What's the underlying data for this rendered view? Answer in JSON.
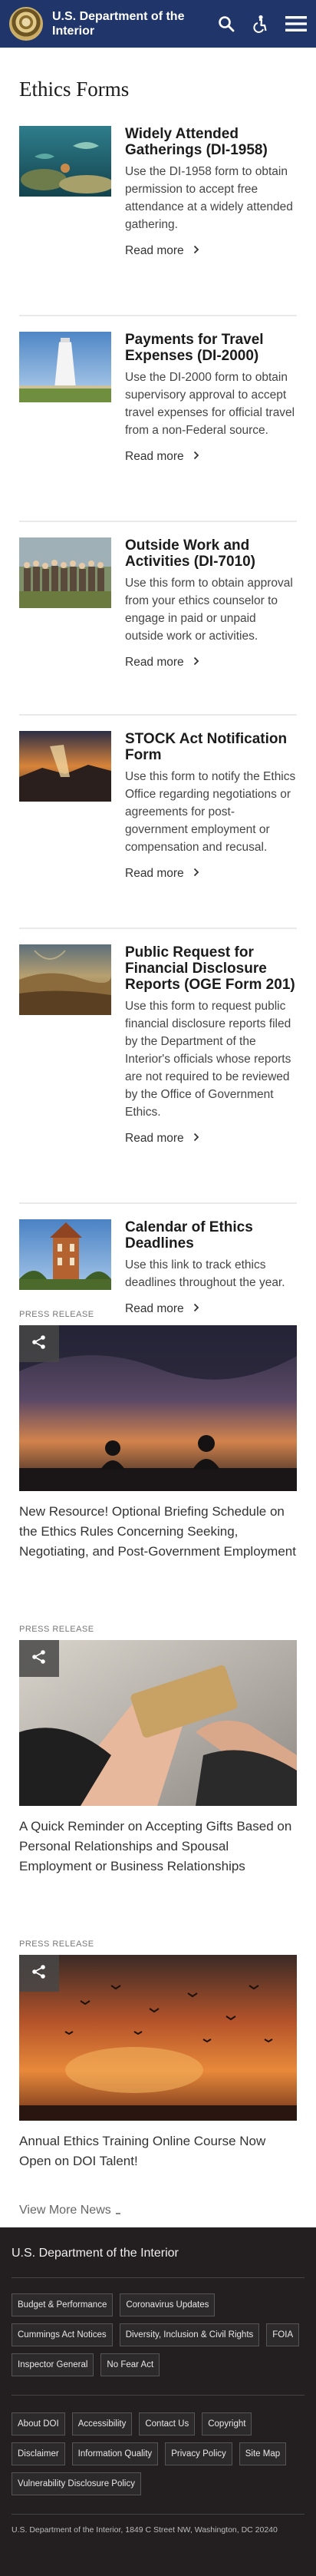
{
  "header": {
    "site_title": "U.S. Department of the Interior",
    "icons": [
      "doi-seal",
      "search-icon",
      "accessibility-icon",
      "menu-icon"
    ],
    "bg_color": "#203569"
  },
  "page_title": "Ethics Forms",
  "forms": [
    {
      "title": "Widely Attended Gatherings (DI-1958)",
      "desc": "Use the DI-1958 form to obtain permission to accept free attendance at a widely attended gathering.",
      "read_more": "Read more"
    },
    {
      "title": "Payments for Travel Expenses (DI-2000)",
      "desc": "Use the DI-2000 form to obtain supervisory approval to accept travel expenses for official travel from a non-Federal source.",
      "read_more": "Read more"
    },
    {
      "title": "Outside Work and Activities (DI-7010)",
      "desc": "Use this form to obtain approval from your ethics counselor to engage in paid or unpaid outside work or activities.",
      "read_more": "Read more"
    },
    {
      "title": "STOCK Act Notification Form",
      "desc": "Use this form to notify the Ethics Office regarding negotiations or agreements for post-government employment or compensation and recusal.",
      "read_more": "Read more"
    },
    {
      "title": "Public Request for Financial Disclosure Reports (OGE Form 201)",
      "desc": "Use this form to request public financial disclosure reports filed by the Department of the Interior's officials whose reports are not required to be reviewed by the Office of Government Ethics.",
      "read_more": "Read more"
    },
    {
      "title": "Calendar of Ethics Deadlines",
      "desc": "Use this link to track ethics deadlines throughout the year.",
      "read_more": "Read more"
    }
  ],
  "press_releases": [
    {
      "label": "PRESS RELEASE",
      "title": "New Resource! Optional Briefing Schedule on the Ethics Rules Concerning Seeking, Negotiating, and Post-Government Employment"
    },
    {
      "label": "PRESS RELEASE",
      "title": "A Quick Reminder on Accepting Gifts Based on Personal Relationships and Spousal Employment or Business Relationships"
    },
    {
      "label": "PRESS RELEASE",
      "title": "Annual Ethics Training Online Course Now Open on DOI Talent!"
    }
  ],
  "view_more": "View More News",
  "footer": {
    "title": "U.S. Department of the Interior",
    "links_primary": [
      "Budget & Performance",
      "Coronavirus Updates",
      "Cummings Act Notices",
      "Diversity, Inclusion & Civil Rights",
      "FOIA",
      "Inspector General",
      "No Fear Act"
    ],
    "links_secondary": [
      "About DOI",
      "Accessibility",
      "Contact Us",
      "Copyright",
      "Disclaimer",
      "Information Quality",
      "Privacy Policy",
      "Site Map",
      "Vulnerability Disclosure Policy"
    ],
    "address": "U.S. Department of the Interior, 1849 C Street NW, Washington, DC 20240",
    "bg_color": "#231f20"
  }
}
